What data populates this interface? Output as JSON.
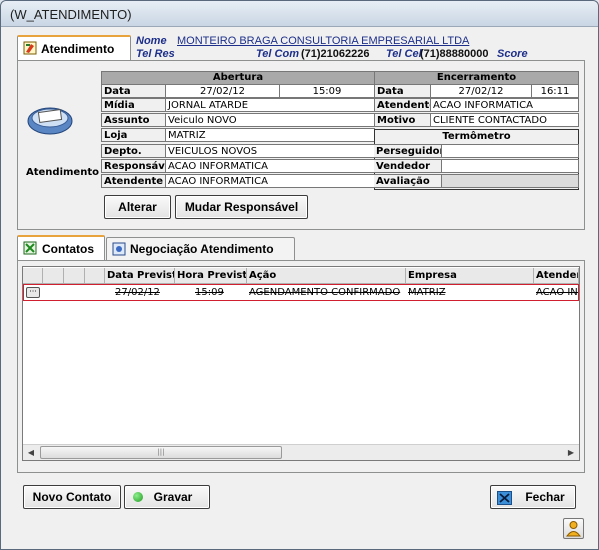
{
  "window": {
    "title": "(W_ATENDIMENTO)"
  },
  "tabs_top": {
    "atendimento": "Atendimento"
  },
  "header": {
    "nome_label": "Nome",
    "nome_value": "MONTEIRO BRAGA CONSULTORIA EMPRESARIAL LTDA",
    "telres_label": "Tel Res",
    "telcom_label": "Tel Com",
    "telcom_value": "(71)21062226",
    "telcel_label": "Tel Cel",
    "telcel_value": "(71)88880000",
    "score_label": "Score"
  },
  "side": {
    "label": "Atendimento"
  },
  "abertura": {
    "title": "Abertura",
    "data_label": "Data",
    "data_value": "27/02/12",
    "hora_value": "15:09",
    "midia_label": "Mídia",
    "midia_value": "JORNAL ATARDE",
    "assunto_label": "Assunto",
    "assunto_value": "Veiculo NOVO",
    "loja_label": "Loja",
    "loja_value": "MATRIZ",
    "depto_label": "Depto.",
    "depto_value": "VEICULOS NOVOS",
    "responsavel_label": "Responsável",
    "responsavel_value": "ACAO INFORMATICA",
    "atendente_label": "Atendente",
    "atendente_value": "ACAO INFORMATICA"
  },
  "encerramento": {
    "title": "Encerramento",
    "data_label": "Data",
    "data_value": "27/02/12",
    "hora_value": "16:11",
    "atendente_label": "Atendente",
    "atendente_value": "ACAO INFORMATICA",
    "motivo_label": "Motivo",
    "motivo_value": "CLIENTE CONTACTADO"
  },
  "termometro": {
    "title": "Termômetro",
    "perseguidor_label": "Perseguidor",
    "vendedor_label": "Vendedor",
    "avaliacao_label": "Avaliação"
  },
  "buttons": {
    "alterar": "Alterar",
    "mudar_responsavel": "Mudar Responsável",
    "novo_contato": "Novo Contato",
    "gravar": "Gravar",
    "fechar": "Fechar"
  },
  "tabs_bottom": {
    "contatos": "Contatos",
    "negociacao": "Negociação Atendimento"
  },
  "grid": {
    "columns": [
      "Data Prevista",
      "Hora Prevista",
      "Ação",
      "Empresa",
      "Atendente"
    ],
    "rows": [
      {
        "data": "27/02/12",
        "hora": "15:09",
        "acao": "AGENDAMENTO CONFIRMADO",
        "empresa": "MATRIZ",
        "atendente": "ACAO INFORMATICA"
      }
    ]
  },
  "colors": {
    "link": "#1d2f8a",
    "selected_row_border": "#d02030",
    "header_gray": "#a9a9a9"
  }
}
